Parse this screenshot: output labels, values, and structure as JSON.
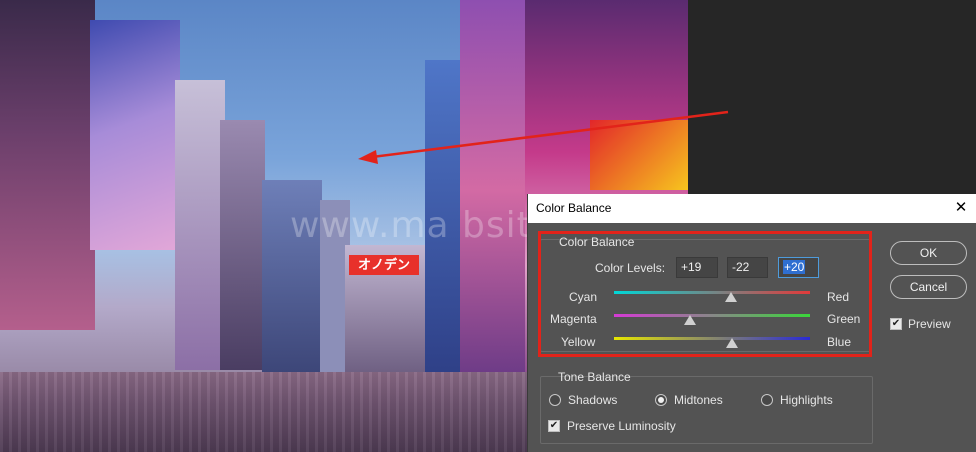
{
  "photo": {
    "sign_text": "オノデン",
    "watermark": "www.ma    bsite.com"
  },
  "dialog": {
    "title": "Color Balance",
    "close_glyph": "✕",
    "color_balance": {
      "group_title": "Color Balance",
      "levels_label": "Color Levels:",
      "levels": [
        "+19",
        "-22",
        "+20"
      ],
      "sliders": [
        {
          "left": "Cyan",
          "right": "Red",
          "value": 19,
          "colors": [
            "#00d7d7",
            "#e23a3a"
          ]
        },
        {
          "left": "Magenta",
          "right": "Green",
          "value": -22,
          "colors": [
            "#d63ad6",
            "#3ad63a"
          ]
        },
        {
          "left": "Yellow",
          "right": "Blue",
          "value": 20,
          "colors": [
            "#e6e600",
            "#2a2ad6"
          ]
        }
      ]
    },
    "tone_balance": {
      "group_title": "Tone Balance",
      "options": [
        "Shadows",
        "Midtones",
        "Highlights"
      ],
      "selected": "Midtones",
      "preserve_label": "Preserve Luminosity",
      "preserve_checked": true
    },
    "buttons": {
      "ok": "OK",
      "cancel": "Cancel"
    },
    "preview": {
      "label": "Preview",
      "checked": true
    }
  },
  "colors": {
    "highlight": "#e2231a",
    "accent": "#2f6fd1"
  }
}
